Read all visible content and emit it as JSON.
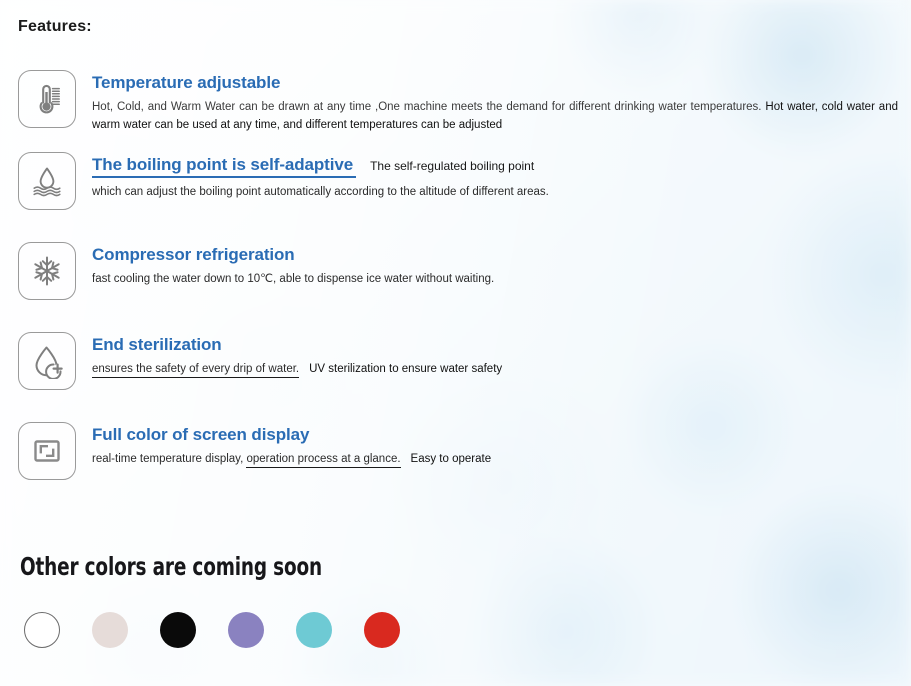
{
  "section": {
    "features_heading": "Features:",
    "accent_color": "#2a6cb4",
    "icon_outline_color": "#9a9a9a"
  },
  "features": [
    {
      "icon": "thermometer-icon",
      "title": "Temperature adjustable",
      "title_underlined": false,
      "title_note": "",
      "desc": "Hot, Cold, and Warm Water can be drawn at any time ,One machine meets the demand for different drinking water temperatures.",
      "desc_extra": "Hot water, cold water and warm water can be used at any time, and different temperatures can be adjusted",
      "desc_note": "",
      "desc_underlined": false
    },
    {
      "icon": "water-drop-waves-icon",
      "title": "The boiling point is self-adaptive",
      "title_underlined": true,
      "title_note": "The self-regulated boiling point",
      "desc": "which can adjust the boiling point automatically according to the altitude of different areas.",
      "desc_extra": "",
      "desc_note": "",
      "desc_underlined": false
    },
    {
      "icon": "snowflake-icon",
      "title": "Compressor refrigeration",
      "title_underlined": false,
      "title_note": "",
      "desc": "fast cooling the water down to 10℃, able to dispense ice water without waiting.",
      "desc_extra": "",
      "desc_note": "",
      "desc_underlined": false
    },
    {
      "icon": "drop-plus-sterilize-icon",
      "title": "End sterilization",
      "title_underlined": false,
      "title_note": "",
      "desc": "ensures the safety of every drip of water.",
      "desc_extra": "",
      "desc_note": "UV sterilization to ensure water safety",
      "desc_underlined": true
    },
    {
      "icon": "screen-display-icon",
      "title": "Full color of screen display",
      "title_underlined": false,
      "title_note": "",
      "desc": "real-time temperature display, ",
      "desc_extra": "operation process at a glance.",
      "desc_note": "Easy to operate",
      "desc_underlined": true
    }
  ],
  "colors": {
    "heading": "Other colors are coming soon",
    "swatches": [
      {
        "name": "white",
        "hex": "#ffffff",
        "outlined": true
      },
      {
        "name": "beige",
        "hex": "#e6dcd9",
        "outlined": false
      },
      {
        "name": "black",
        "hex": "#0a0a0a",
        "outlined": false
      },
      {
        "name": "purple",
        "hex": "#8a82c0",
        "outlined": false
      },
      {
        "name": "turquoise",
        "hex": "#6ecad4",
        "outlined": false
      },
      {
        "name": "red",
        "hex": "#d9291f",
        "outlined": false
      }
    ]
  }
}
